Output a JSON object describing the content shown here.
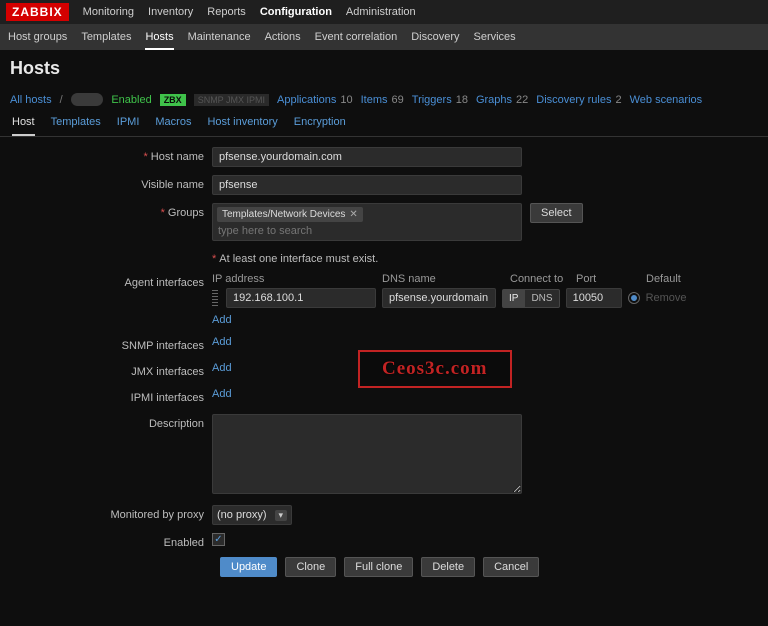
{
  "brand": "ZABBIX",
  "topnav": {
    "items": [
      "Monitoring",
      "Inventory",
      "Reports",
      "Configuration",
      "Administration"
    ],
    "active": 3
  },
  "subnav": {
    "items": [
      "Host groups",
      "Templates",
      "Hosts",
      "Maintenance",
      "Actions",
      "Event correlation",
      "Discovery",
      "Services"
    ],
    "active": 2
  },
  "page_title": "Hosts",
  "filterrow": {
    "all_hosts": "All hosts",
    "status": "Enabled",
    "zbx": "ZBX",
    "snmp": "SNMP JMX IPMI",
    "items": [
      {
        "label": "Applications",
        "count": 10
      },
      {
        "label": "Items",
        "count": 69
      },
      {
        "label": "Triggers",
        "count": 18
      },
      {
        "label": "Graphs",
        "count": 22
      },
      {
        "label": "Discovery rules",
        "count": 2
      },
      {
        "label": "Web scenarios",
        "count": ""
      }
    ]
  },
  "tabs": {
    "items": [
      "Host",
      "Templates",
      "IPMI",
      "Macros",
      "Host inventory",
      "Encryption"
    ],
    "active": 0
  },
  "form": {
    "host_name_label": "Host name",
    "host_name": "pfsense.yourdomain.com",
    "visible_name_label": "Visible name",
    "visible_name": "pfsense",
    "groups_label": "Groups",
    "group_tag": "Templates/Network Devices",
    "groups_placeholder": "type here to search",
    "select_btn": "Select",
    "iface_hint": "At least one interface must exist.",
    "agent_if_label": "Agent interfaces",
    "iface_headers": {
      "ip": "IP address",
      "dns": "DNS name",
      "connect": "Connect to",
      "port": "Port",
      "default": "Default"
    },
    "agent_if": {
      "ip": "192.168.100.1",
      "dns": "pfsense.yourdomain.com",
      "conn_ip": "IP",
      "conn_dns": "DNS",
      "port": "10050",
      "remove": "Remove"
    },
    "add_link": "Add",
    "snmp_if_label": "SNMP interfaces",
    "jmx_if_label": "JMX interfaces",
    "ipmi_if_label": "IPMI interfaces",
    "description_label": "Description",
    "description": "",
    "monitored_by_label": "Monitored by proxy",
    "monitored_by_value": "(no proxy)",
    "enabled_label": "Enabled",
    "enabled": true,
    "buttons": {
      "update": "Update",
      "clone": "Clone",
      "full_clone": "Full clone",
      "delete": "Delete",
      "cancel": "Cancel"
    }
  },
  "watermark": "Ceos3c.com"
}
